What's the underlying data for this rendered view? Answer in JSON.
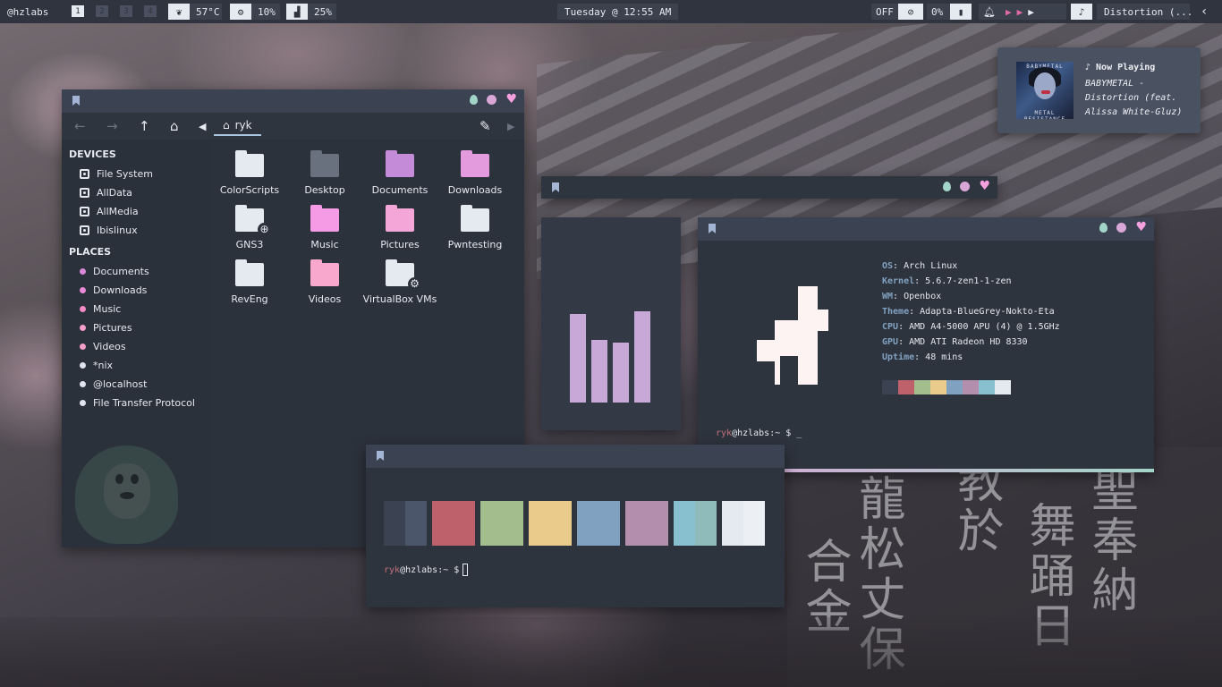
{
  "topbar": {
    "host": "@hzlabs",
    "workspaces": [
      "1",
      "2",
      "3",
      "4"
    ],
    "temp": "57°C",
    "cpu": "10%",
    "mem": "25%",
    "clock": "Tuesday @ 12:55 AM",
    "wifi": "OFF",
    "battery": "0%",
    "track": "Distortion (...",
    "collapse_icon": "chevron-left-icon"
  },
  "filemanager": {
    "location": "ryk",
    "devices_label": "DEVICES",
    "devices": [
      "File System",
      "AllData",
      "AllMedia",
      "Ibislinux"
    ],
    "places_label": "PLACES",
    "places": [
      {
        "label": "Documents",
        "color": "#d889d9"
      },
      {
        "label": "Downloads",
        "color": "#e98ad8"
      },
      {
        "label": "Music",
        "color": "#f48ac6"
      },
      {
        "label": "Pictures",
        "color": "#f59fcf"
      },
      {
        "label": "Videos",
        "color": "#f5a0c8"
      },
      {
        "label": "*nix",
        "color": "#dfe4ef"
      },
      {
        "label": "@localhost",
        "color": "#dfe4ef"
      },
      {
        "label": "File Transfer Protocol",
        "color": "#dfe4ef"
      }
    ],
    "folders": [
      {
        "label": "ColorScripts",
        "color": "#e5e9f0"
      },
      {
        "label": "Desktop",
        "color": "#6a717e"
      },
      {
        "label": "Documents",
        "color": "#c48bd9"
      },
      {
        "label": "Downloads",
        "color": "#e39bde"
      },
      {
        "label": "GNS3",
        "color": "#e5e9f0",
        "badge": "globe"
      },
      {
        "label": "Music",
        "color": "#f59be6"
      },
      {
        "label": "Pictures",
        "color": "#f5a6d9"
      },
      {
        "label": "Pwntesting",
        "color": "#e5e9f0"
      },
      {
        "label": "RevEng",
        "color": "#e5e9f0"
      },
      {
        "label": "Videos",
        "color": "#f7a8cc"
      },
      {
        "label": "VirtualBox VMs",
        "color": "#e5e9f0",
        "badge": "gear"
      }
    ]
  },
  "neofetch": {
    "info": [
      {
        "key": "OS",
        "value": "Arch Linux"
      },
      {
        "key": "Kernel",
        "value": "5.6.7-zen1-1-zen"
      },
      {
        "key": "WM",
        "value": "Openbox"
      },
      {
        "key": "Theme",
        "value": "Adapta-BlueGrey-Nokto-Eta"
      },
      {
        "key": "CPU",
        "value": "AMD A4-5000 APU (4) @ 1.5GHz"
      },
      {
        "key": "GPU",
        "value": "AMD ATI Radeon HD 8330"
      },
      {
        "key": "Uptime",
        "value": "48 mins"
      }
    ],
    "palette": [
      "#3b4252",
      "#bf616a",
      "#a3be8c",
      "#ebcb8b",
      "#81a1c1",
      "#b48ead",
      "#88c0d0",
      "#e5e9f0"
    ],
    "prompt_user": "ryk",
    "prompt_rest": "@hzlabs:~ $"
  },
  "visualizer": {
    "levels": [
      0.62,
      0.44,
      0.42,
      0.64
    ],
    "color": "#c8a8d6"
  },
  "colors": {
    "pairs": [
      [
        "#3b4252",
        "#4c566a"
      ],
      [
        "#bf616a",
        "#bf616a"
      ],
      [
        "#a3be8c",
        "#a3be8c"
      ],
      [
        "#ebcb8b",
        "#ebcb8b"
      ],
      [
        "#81a1c1",
        "#81a1c1"
      ],
      [
        "#b48ead",
        "#b48ead"
      ],
      [
        "#88c0d0",
        "#8fbcbb"
      ],
      [
        "#e5e9f0",
        "#eceff4"
      ]
    ],
    "prompt_user": "ryk",
    "prompt_rest": "@hzlabs:~ $"
  },
  "nowplaying": {
    "heading": "♪ Now Playing",
    "title": "BABYMETAL - Distortion (feat. Alissa White-Gluz)",
    "art_text_top": "BABYMETAL",
    "art_text_bottom": "METAL RESISTANCE"
  }
}
